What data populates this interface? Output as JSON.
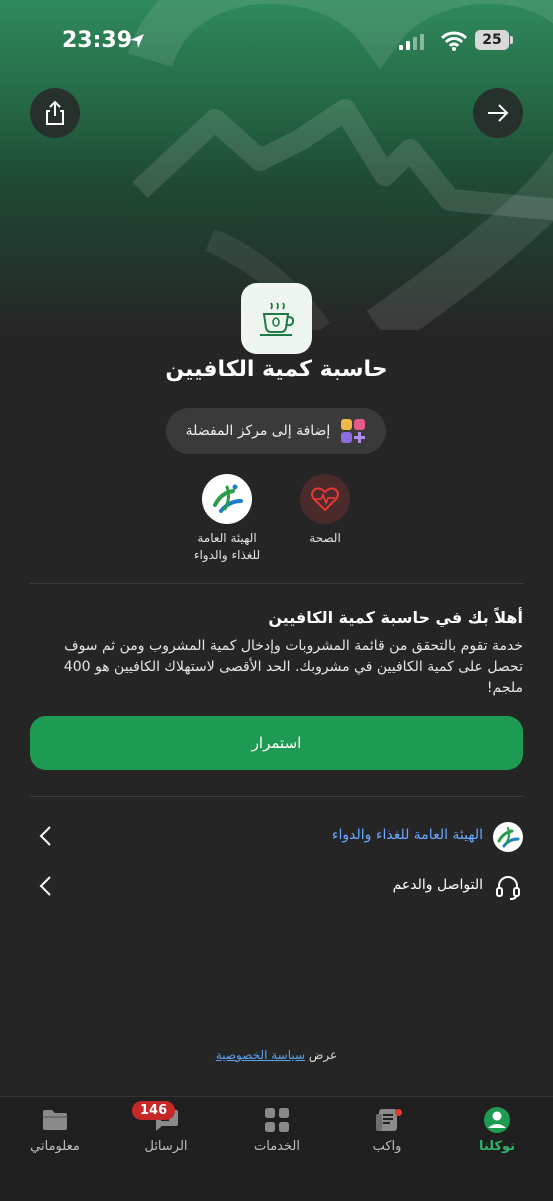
{
  "status_bar": {
    "time": "23:39",
    "battery": "25"
  },
  "app": {
    "title": "حاسبة كمية الكافيين",
    "favorite_label": "إضافة إلى مركز المفضلة"
  },
  "tags": [
    {
      "label": "الصحة"
    },
    {
      "label": "الهيئة العامة للغذاء والدواء"
    }
  ],
  "welcome": {
    "title": "أهلاً بك في حاسبة كمية الكافيين",
    "description": "خدمة تقوم بالتحقق من قائمة المشروبات وإدخال كمية المشروب ومن ثم سوف تحصل على كمية الكافيين في مشروبك. الحد الأقصى لاستهلاك الكافيين هو 400 ملجم!"
  },
  "continue_label": "استمرار",
  "links": [
    {
      "label": "الهيئة العامة للغذاء والدواء",
      "color": "#6aa8ff"
    },
    {
      "label": "التواصل والدعم",
      "color": "#ffffff"
    }
  ],
  "privacy": {
    "prefix": "عرض",
    "link": "سياسة الخصوصية"
  },
  "tabbar": {
    "tabs": [
      {
        "label": "توكلنا",
        "active": true
      },
      {
        "label": "واكب"
      },
      {
        "label": "الخدمات"
      },
      {
        "label": "الرسائل",
        "badge": "146"
      },
      {
        "label": "معلوماتي"
      }
    ]
  },
  "colors": {
    "accent": "#1e9b52",
    "background": "#252525"
  }
}
